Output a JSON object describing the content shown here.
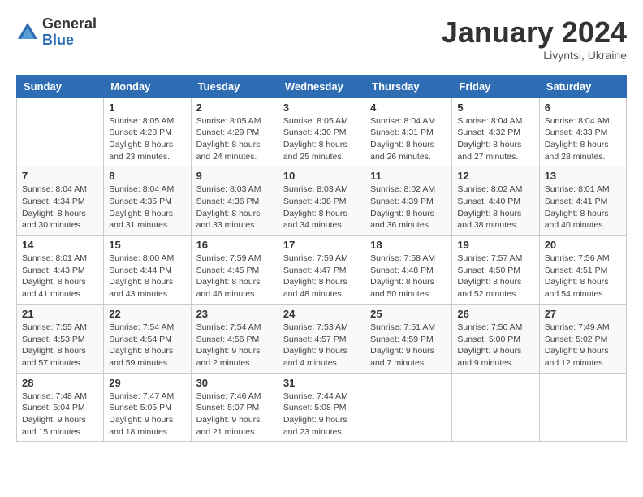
{
  "header": {
    "logo_general": "General",
    "logo_blue": "Blue",
    "month": "January 2024",
    "location": "Livyntsi, Ukraine"
  },
  "days_of_week": [
    "Sunday",
    "Monday",
    "Tuesday",
    "Wednesday",
    "Thursday",
    "Friday",
    "Saturday"
  ],
  "weeks": [
    [
      {
        "day": "",
        "info": ""
      },
      {
        "day": "1",
        "info": "Sunrise: 8:05 AM\nSunset: 4:28 PM\nDaylight: 8 hours\nand 23 minutes."
      },
      {
        "day": "2",
        "info": "Sunrise: 8:05 AM\nSunset: 4:29 PM\nDaylight: 8 hours\nand 24 minutes."
      },
      {
        "day": "3",
        "info": "Sunrise: 8:05 AM\nSunset: 4:30 PM\nDaylight: 8 hours\nand 25 minutes."
      },
      {
        "day": "4",
        "info": "Sunrise: 8:04 AM\nSunset: 4:31 PM\nDaylight: 8 hours\nand 26 minutes."
      },
      {
        "day": "5",
        "info": "Sunrise: 8:04 AM\nSunset: 4:32 PM\nDaylight: 8 hours\nand 27 minutes."
      },
      {
        "day": "6",
        "info": "Sunrise: 8:04 AM\nSunset: 4:33 PM\nDaylight: 8 hours\nand 28 minutes."
      }
    ],
    [
      {
        "day": "7",
        "info": "Sunrise: 8:04 AM\nSunset: 4:34 PM\nDaylight: 8 hours\nand 30 minutes."
      },
      {
        "day": "8",
        "info": "Sunrise: 8:04 AM\nSunset: 4:35 PM\nDaylight: 8 hours\nand 31 minutes."
      },
      {
        "day": "9",
        "info": "Sunrise: 8:03 AM\nSunset: 4:36 PM\nDaylight: 8 hours\nand 33 minutes."
      },
      {
        "day": "10",
        "info": "Sunrise: 8:03 AM\nSunset: 4:38 PM\nDaylight: 8 hours\nand 34 minutes."
      },
      {
        "day": "11",
        "info": "Sunrise: 8:02 AM\nSunset: 4:39 PM\nDaylight: 8 hours\nand 36 minutes."
      },
      {
        "day": "12",
        "info": "Sunrise: 8:02 AM\nSunset: 4:40 PM\nDaylight: 8 hours\nand 38 minutes."
      },
      {
        "day": "13",
        "info": "Sunrise: 8:01 AM\nSunset: 4:41 PM\nDaylight: 8 hours\nand 40 minutes."
      }
    ],
    [
      {
        "day": "14",
        "info": "Sunrise: 8:01 AM\nSunset: 4:43 PM\nDaylight: 8 hours\nand 41 minutes."
      },
      {
        "day": "15",
        "info": "Sunrise: 8:00 AM\nSunset: 4:44 PM\nDaylight: 8 hours\nand 43 minutes."
      },
      {
        "day": "16",
        "info": "Sunrise: 7:59 AM\nSunset: 4:45 PM\nDaylight: 8 hours\nand 46 minutes."
      },
      {
        "day": "17",
        "info": "Sunrise: 7:59 AM\nSunset: 4:47 PM\nDaylight: 8 hours\nand 48 minutes."
      },
      {
        "day": "18",
        "info": "Sunrise: 7:58 AM\nSunset: 4:48 PM\nDaylight: 8 hours\nand 50 minutes."
      },
      {
        "day": "19",
        "info": "Sunrise: 7:57 AM\nSunset: 4:50 PM\nDaylight: 8 hours\nand 52 minutes."
      },
      {
        "day": "20",
        "info": "Sunrise: 7:56 AM\nSunset: 4:51 PM\nDaylight: 8 hours\nand 54 minutes."
      }
    ],
    [
      {
        "day": "21",
        "info": "Sunrise: 7:55 AM\nSunset: 4:53 PM\nDaylight: 8 hours\nand 57 minutes."
      },
      {
        "day": "22",
        "info": "Sunrise: 7:54 AM\nSunset: 4:54 PM\nDaylight: 8 hours\nand 59 minutes."
      },
      {
        "day": "23",
        "info": "Sunrise: 7:54 AM\nSunset: 4:56 PM\nDaylight: 9 hours\nand 2 minutes."
      },
      {
        "day": "24",
        "info": "Sunrise: 7:53 AM\nSunset: 4:57 PM\nDaylight: 9 hours\nand 4 minutes."
      },
      {
        "day": "25",
        "info": "Sunrise: 7:51 AM\nSunset: 4:59 PM\nDaylight: 9 hours\nand 7 minutes."
      },
      {
        "day": "26",
        "info": "Sunrise: 7:50 AM\nSunset: 5:00 PM\nDaylight: 9 hours\nand 9 minutes."
      },
      {
        "day": "27",
        "info": "Sunrise: 7:49 AM\nSunset: 5:02 PM\nDaylight: 9 hours\nand 12 minutes."
      }
    ],
    [
      {
        "day": "28",
        "info": "Sunrise: 7:48 AM\nSunset: 5:04 PM\nDaylight: 9 hours\nand 15 minutes."
      },
      {
        "day": "29",
        "info": "Sunrise: 7:47 AM\nSunset: 5:05 PM\nDaylight: 9 hours\nand 18 minutes."
      },
      {
        "day": "30",
        "info": "Sunrise: 7:46 AM\nSunset: 5:07 PM\nDaylight: 9 hours\nand 21 minutes."
      },
      {
        "day": "31",
        "info": "Sunrise: 7:44 AM\nSunset: 5:08 PM\nDaylight: 9 hours\nand 23 minutes."
      },
      {
        "day": "",
        "info": ""
      },
      {
        "day": "",
        "info": ""
      },
      {
        "day": "",
        "info": ""
      }
    ]
  ]
}
